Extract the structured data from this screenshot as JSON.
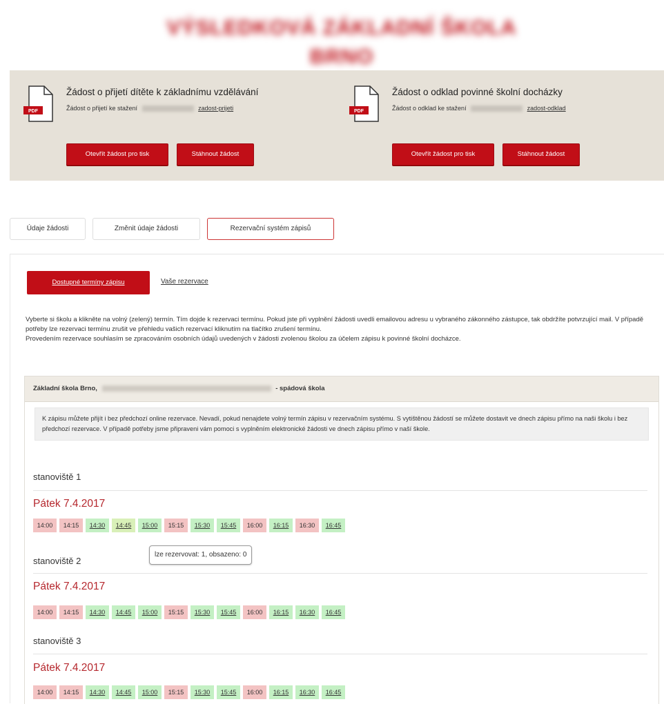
{
  "site": {
    "title": "VÝSLEDKOVÁ ZÁKLADNÍ ŠKOLA BRNO"
  },
  "documents": [
    {
      "title": "Žádost o přijetí dítěte k základnímu vzdělávání",
      "line_prefix": "Žádost o přijetí ke stažení",
      "link": "zadost-prijeti",
      "open_label": "Otevřít žádost pro tisk",
      "download_label": "Stáhnout žádost",
      "icon": "pdf-icon"
    },
    {
      "title": "Žádost o odklad povinné školní docházky",
      "line_prefix": "Žádost o odklad ke stažení",
      "link": "zadost-odklad",
      "open_label": "Otevřít žádost pro tisk",
      "download_label": "Stáhnout žádost",
      "icon": "pdf-icon"
    }
  ],
  "tabs": [
    {
      "label": "Údaje žádosti",
      "active": false
    },
    {
      "label": "Změnit údaje žádosti",
      "active": false
    },
    {
      "label": "Rezervační systém zápisů",
      "active": true
    }
  ],
  "subtabs": [
    {
      "label": "Dostupné termíny zápisu",
      "active": true
    },
    {
      "label": "Vaše rezervace",
      "active": false
    }
  ],
  "intro": {
    "p1": "Vyberte si školu a klikněte na volný (zelený) termín. Tím dojde k rezervaci termínu. Pokud jste při vyplnění žádosti uvedli emailovou adresu u vybraného zákonného zástupce, tak obdržíte potvrzující mail. V případě potřeby lze rezervaci termínu zrušit ve přehledu vašich rezervací kliknutím na tlačítko zrušení termínu.",
    "p2": "Provedením rezervace souhlasím se zpracováním osobních údajů uvedených v žádosti zvolenou školou za účelem zápisu k povinné školní docházce."
  },
  "school": {
    "name_prefix": "Základní škola Brno,",
    "name_suffix": "- spádová škola",
    "notice": "K zápisu můžete přijít i bez předchozí online rezervace. Nevadí, pokud nenajdete volný termín zápisu v rezervačním systému. S vytištěnou žádostí se můžete dostavit ve dnech zápisu přímo na naši školu i bez předchozí rezervace. V případě potřeby jsme připraveni vám pomoci s vyplněním elektronické žádosti ve dnech zápisu přímo v naší škole."
  },
  "stations": [
    {
      "label": "stanoviště 1",
      "day": "Pátek 7.4.2017",
      "slots": [
        {
          "time": "14:00",
          "status": "busy"
        },
        {
          "time": "14:15",
          "status": "busy"
        },
        {
          "time": "14:30",
          "status": "free"
        },
        {
          "time": "14:45",
          "status": "free",
          "hover": true
        },
        {
          "time": "15:00",
          "status": "free"
        },
        {
          "time": "15:15",
          "status": "busy"
        },
        {
          "time": "15:30",
          "status": "free"
        },
        {
          "time": "15:45",
          "status": "free"
        },
        {
          "time": "16:00",
          "status": "busy"
        },
        {
          "time": "16:15",
          "status": "free"
        },
        {
          "time": "16:30",
          "status": "busy"
        },
        {
          "time": "16:45",
          "status": "free"
        }
      ]
    },
    {
      "label": "stanoviště 2",
      "day": "Pátek 7.4.2017",
      "slots": [
        {
          "time": "14:00",
          "status": "busy"
        },
        {
          "time": "14:15",
          "status": "busy"
        },
        {
          "time": "14:30",
          "status": "free"
        },
        {
          "time": "14:45",
          "status": "free"
        },
        {
          "time": "15:00",
          "status": "free"
        },
        {
          "time": "15:15",
          "status": "busy"
        },
        {
          "time": "15:30",
          "status": "free"
        },
        {
          "time": "15:45",
          "status": "free"
        },
        {
          "time": "16:00",
          "status": "busy"
        },
        {
          "time": "16:15",
          "status": "free"
        },
        {
          "time": "16:30",
          "status": "free"
        },
        {
          "time": "16:45",
          "status": "free"
        }
      ]
    },
    {
      "label": "stanoviště 3",
      "day": "Pátek 7.4.2017",
      "slots": [
        {
          "time": "14:00",
          "status": "busy"
        },
        {
          "time": "14:15",
          "status": "busy"
        },
        {
          "time": "14:30",
          "status": "free"
        },
        {
          "time": "14:45",
          "status": "free"
        },
        {
          "time": "15:00",
          "status": "free"
        },
        {
          "time": "15:15",
          "status": "busy"
        },
        {
          "time": "15:30",
          "status": "free"
        },
        {
          "time": "15:45",
          "status": "free"
        },
        {
          "time": "16:00",
          "status": "busy"
        },
        {
          "time": "16:15",
          "status": "free"
        },
        {
          "time": "16:30",
          "status": "free"
        },
        {
          "time": "16:45",
          "status": "free"
        }
      ]
    }
  ],
  "tooltip": {
    "text": "lze rezervovat: 1, obsazeno: 0"
  },
  "colors": {
    "accent": "#c10e17",
    "busy": "#f3c3c3",
    "free": "#c4f0c4",
    "band": "#e6e1d8",
    "day": "#b5272d"
  }
}
